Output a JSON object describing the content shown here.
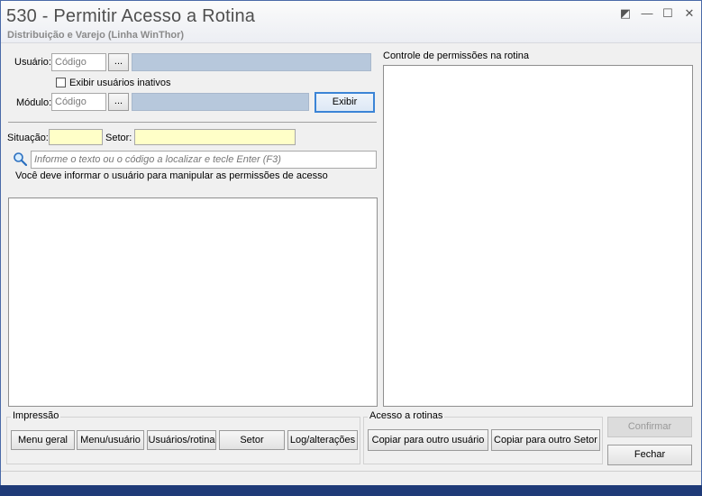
{
  "window": {
    "title": "530 - Permitir Acesso a Rotina",
    "subtitle": "Distribuição e Varejo (Linha WinThor)",
    "controls": {
      "restore": "◩",
      "minimize": "—",
      "maximize": "☐",
      "close": "✕"
    }
  },
  "form": {
    "usuario_label": "Usuário:",
    "usuario_code_placeholder": "Código",
    "lookup_button": "...",
    "exibir_inativos_label": "Exibir usuários inativos",
    "modulo_label": "Módulo:",
    "modulo_code_placeholder": "Código",
    "exibir_button": "Exibir",
    "situacao_label": "Situação:",
    "setor_label": "Setor:",
    "search_placeholder": "Informe o texto ou o código a localizar e tecle Enter (F3)",
    "info_message": "Você deve informar o usuário para manipular as permissões de acesso"
  },
  "right_panel": {
    "label": "Controle de permissões na rotina"
  },
  "impressao": {
    "label": "Impressão",
    "buttons": [
      "Menu geral",
      "Menu/usuário",
      "Usuários/rotina",
      "Setor",
      "Log/alterações"
    ]
  },
  "acesso": {
    "label": "Acesso a rotinas",
    "buttons": [
      "Copiar para outro usuário",
      "Copiar para outro Setor"
    ]
  },
  "actions": {
    "confirmar": "Confirmar",
    "fechar": "Fechar"
  },
  "colors": {
    "yellow_field": "#ffffc8",
    "blue_field": "#b7c8dc",
    "focus_border": "#3b84d6"
  }
}
